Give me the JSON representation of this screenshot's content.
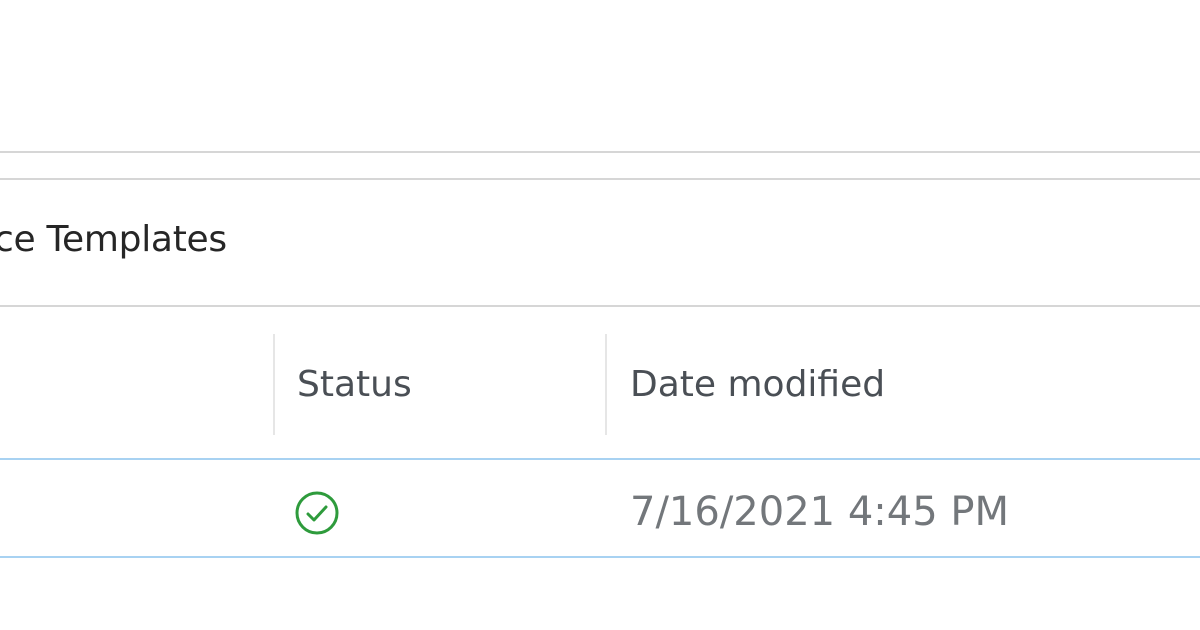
{
  "breadcrumb": {
    "label": "ce Templates"
  },
  "table": {
    "columns": [
      {
        "label": "Status"
      },
      {
        "label": "Date modified"
      }
    ],
    "rows": [
      {
        "status": "synced",
        "status_icon": "check-circle-icon",
        "date_modified": "7/16/2021 4:45 PM"
      }
    ]
  },
  "colors": {
    "status_ok": "#2e9b3c",
    "row_border": "#a8d2f2",
    "divider": "#d6d6d6"
  }
}
